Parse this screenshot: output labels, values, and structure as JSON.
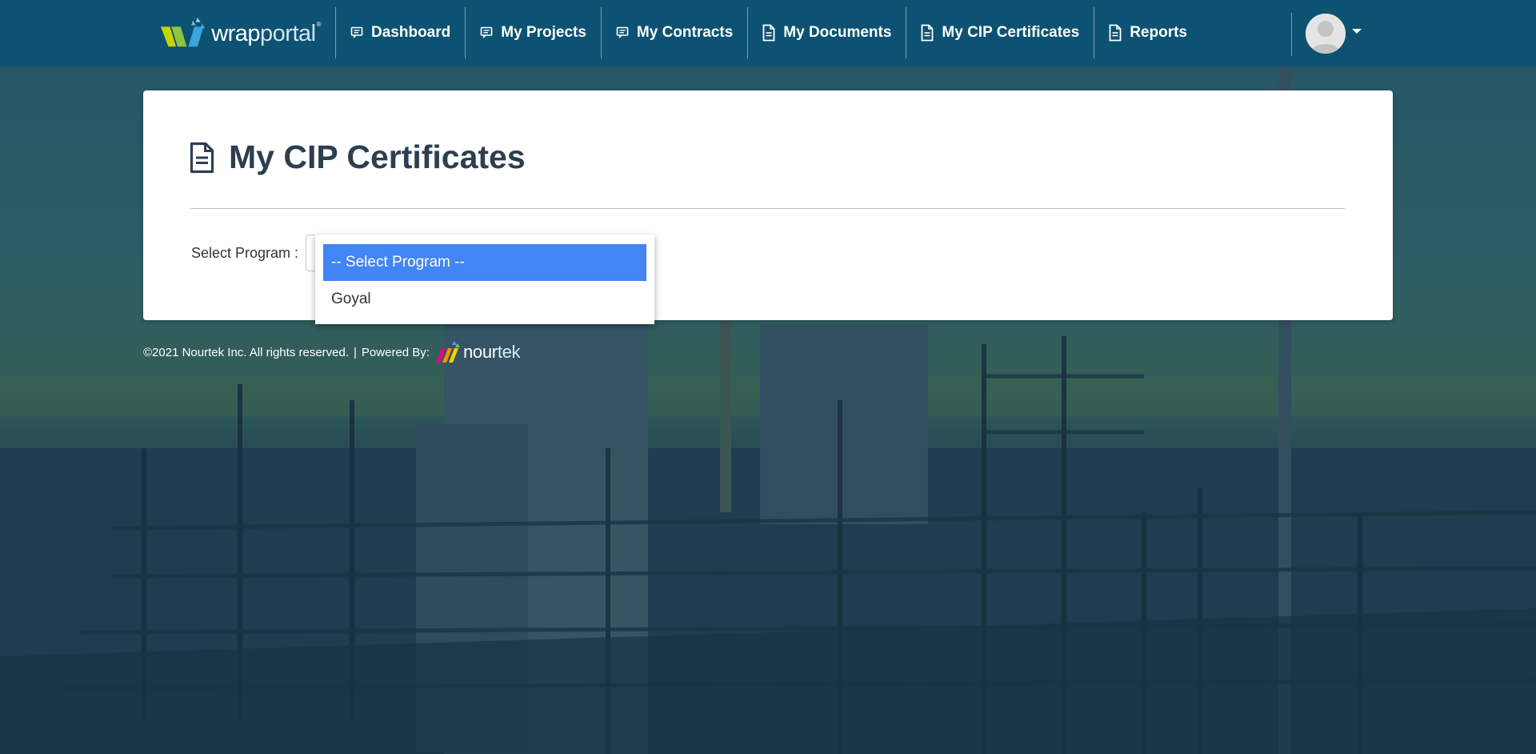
{
  "brand": {
    "name_bold": "wrap",
    "name_light": "portal",
    "reg": "®"
  },
  "nav": {
    "items": [
      {
        "label": "Dashboard",
        "icon": "comment-icon"
      },
      {
        "label": "My Projects",
        "icon": "comment-icon"
      },
      {
        "label": "My Contracts",
        "icon": "comment-icon"
      },
      {
        "label": "My Documents",
        "icon": "document-icon"
      },
      {
        "label": "My CIP Certificates",
        "icon": "document-icon"
      },
      {
        "label": "Reports",
        "icon": "document-icon"
      }
    ],
    "user_menu": {
      "avatar_icon": "user-avatar-icon",
      "caret_icon": "caret-down-icon"
    }
  },
  "page": {
    "title": "My CIP Certificates",
    "title_icon": "document-icon",
    "select_label": "Select Program :"
  },
  "dropdown": {
    "options": [
      {
        "label": "-- Select Program --",
        "selected": true
      },
      {
        "label": "Goyal",
        "selected": false
      }
    ]
  },
  "footer": {
    "copyright": "©2021 Nourtek Inc. All rights reserved.",
    "separator": "|",
    "powered_by": "Powered By:",
    "brand_bold": "nour",
    "brand_light": "tek"
  },
  "colors": {
    "navbar": "#0d5273",
    "title": "#2d3e50",
    "selected_option": "#4285f4"
  }
}
